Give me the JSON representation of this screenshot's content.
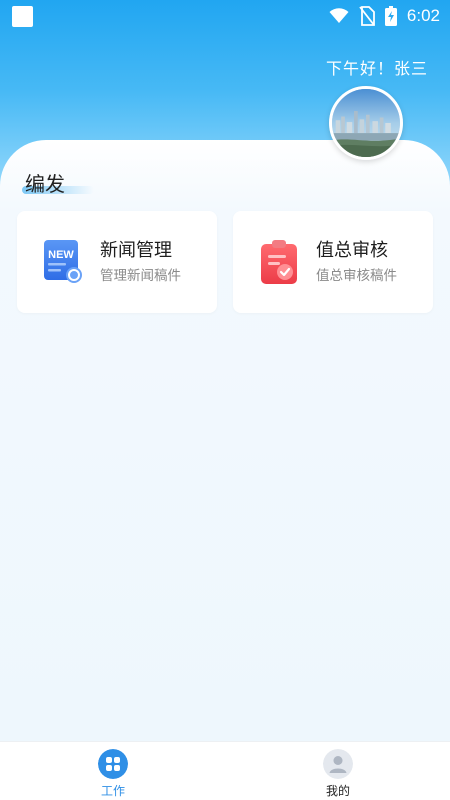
{
  "status_bar": {
    "time": "6:02",
    "icons": [
      "notification-square-icon",
      "wifi-icon",
      "no-sim-icon",
      "battery-charging-icon"
    ]
  },
  "header": {
    "greeting": "下午好！张三",
    "avatar_icon": "city-skyline-avatar"
  },
  "section": {
    "title": "编发"
  },
  "tiles": [
    {
      "title": "新闻管理",
      "subtitle": "管理新闻稿件",
      "icon": "news-badge-icon",
      "icon_text": "NEW",
      "accent": "#3d7ef0"
    },
    {
      "title": "值总审核",
      "subtitle": "值总审核稿件",
      "icon": "clipboard-check-icon",
      "accent": "#f04a55"
    }
  ],
  "bottom_nav": {
    "items": [
      {
        "label": "工作",
        "icon": "grid-icon",
        "active": true,
        "color": "#2f8fe6"
      },
      {
        "label": "我的",
        "icon": "user-icon",
        "active": false,
        "color": "#222222"
      }
    ]
  }
}
